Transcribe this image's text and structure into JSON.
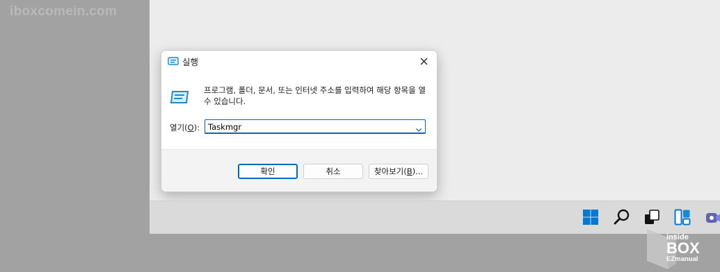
{
  "watermark": {
    "text": "iboxcomein.com"
  },
  "dialog": {
    "title": "실행",
    "description": "프로그램, 폴더, 문서, 또는 인터넷 주소를 입력하여 해당 항목을 열 수 있습니다.",
    "open_label_prefix": "열기(",
    "open_label_key": "O",
    "open_label_suffix": "):",
    "input_value": "Taskmgr",
    "ok_label": "확인",
    "cancel_label": "취소",
    "browse_label_prefix": "찾아보기(",
    "browse_label_key": "B",
    "browse_label_suffix": ")..."
  },
  "taskbar": {
    "icons": [
      "windows-start-icon",
      "search-icon",
      "task-view-icon",
      "widgets-icon",
      "chat-icon"
    ]
  },
  "branding": {
    "line1": "inside",
    "line2": "BOX",
    "line3": "EZmanual"
  },
  "colors": {
    "accent": "#0067c0",
    "start_blue": "#0078d4"
  }
}
